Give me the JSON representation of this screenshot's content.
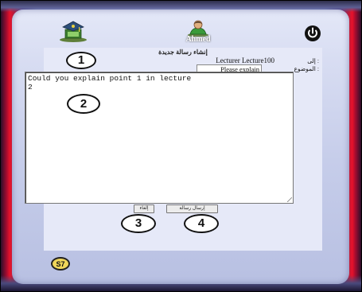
{
  "header": {
    "user_name": "Ahmed",
    "logo_icon": "graduation-cap-logo-icon",
    "user_icon": "user-avatar-icon",
    "logout_icon": "power-icon"
  },
  "form": {
    "title": "إنشاء رسالة جديدة",
    "to_label": "إلى :",
    "to_value": "Lecturer Lecture100",
    "subject_label": "الموضوع :",
    "subject_value": "Please explain",
    "message_body": "Could you explain point 1 in lecture\n2",
    "cancel_label": "إلغاء",
    "send_label": "إرسال رسالة"
  },
  "annotations": {
    "callout_1": "1",
    "callout_2": "2",
    "callout_3": "3",
    "callout_4": "4",
    "page_badge": "S7"
  },
  "colors": {
    "frame_red": "#e8122a",
    "frame_blue": "#7a89c8",
    "panel": "#d8ddf2",
    "badge": "#f0d65a"
  }
}
